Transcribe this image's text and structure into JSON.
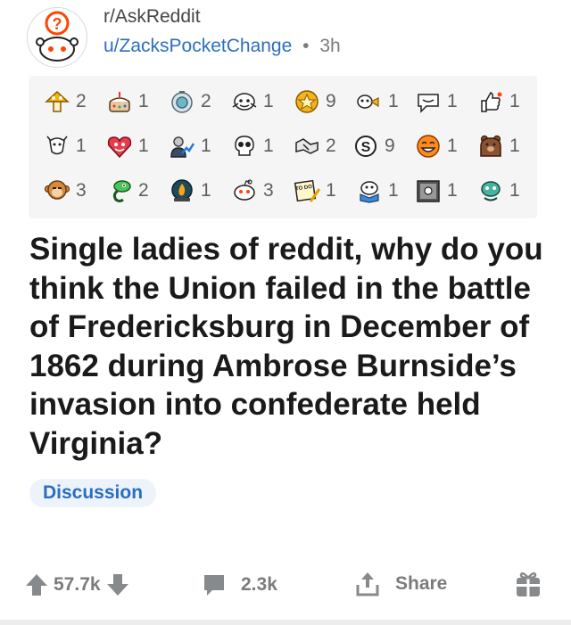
{
  "post": {
    "subreddit": "r/AskReddit",
    "username": "u/ZacksPocketChange",
    "separator": "•",
    "age": "3h",
    "title": "Single ladies of reddit, why do you think the Union failed in the battle of Fredericksburg in December of 1862 during Ambrose Burnside’s invasion into confederate held Virginia?",
    "flair": "Discussion"
  },
  "awards": [
    {
      "icon": "mushroom-award-icon",
      "count": "2"
    },
    {
      "icon": "cake-award-icon",
      "count": "1"
    },
    {
      "icon": "silver-coin-award-icon",
      "count": "2"
    },
    {
      "icon": "snoo-hug-award-icon",
      "count": "1"
    },
    {
      "icon": "gold-star-award-icon",
      "count": "9"
    },
    {
      "icon": "snoo-trumpet-award-icon",
      "count": "1"
    },
    {
      "icon": "speech-bubble-award-icon",
      "count": "1"
    },
    {
      "icon": "thumbs-up-award-icon",
      "count": "1"
    },
    {
      "icon": "goat-award-icon",
      "count": "1"
    },
    {
      "icon": "heart-face-award-icon",
      "count": "1"
    },
    {
      "icon": "stonks-award-icon",
      "count": "1"
    },
    {
      "icon": "skull-award-icon",
      "count": "1"
    },
    {
      "icon": "handshake-award-icon",
      "count": "2"
    },
    {
      "icon": "coin-s-award-icon",
      "count": "9"
    },
    {
      "icon": "laughing-face-award-icon",
      "count": "1"
    },
    {
      "icon": "bear-award-icon",
      "count": "1"
    },
    {
      "icon": "monkey-award-icon",
      "count": "3"
    },
    {
      "icon": "snake-award-icon",
      "count": "2"
    },
    {
      "icon": "fire-snowglobe-award-icon",
      "count": "1"
    },
    {
      "icon": "snoo-face-award-icon",
      "count": "3"
    },
    {
      "icon": "todo-list-award-icon",
      "count": "1",
      "text": "TO DO"
    },
    {
      "icon": "snoo-reading-award-icon",
      "count": "1"
    },
    {
      "icon": "vault-award-icon",
      "count": "1"
    },
    {
      "icon": "snoo-wave-award-icon",
      "count": "1"
    }
  ],
  "actions": {
    "upvote_icon": "arrow-up-icon",
    "score": "57.7k",
    "downvote_icon": "arrow-down-icon",
    "comments_icon": "comment-icon",
    "comments": "2.3k",
    "share_icon": "share-icon",
    "share_label": "Share",
    "gift_icon": "gift-icon"
  },
  "colors": {
    "link": "#2c6fbf",
    "flair_bg": "#edf3fb",
    "flair_text": "#2a6ebd",
    "muted": "#7c7c7c",
    "awards_bg": "#f5f5f5"
  }
}
